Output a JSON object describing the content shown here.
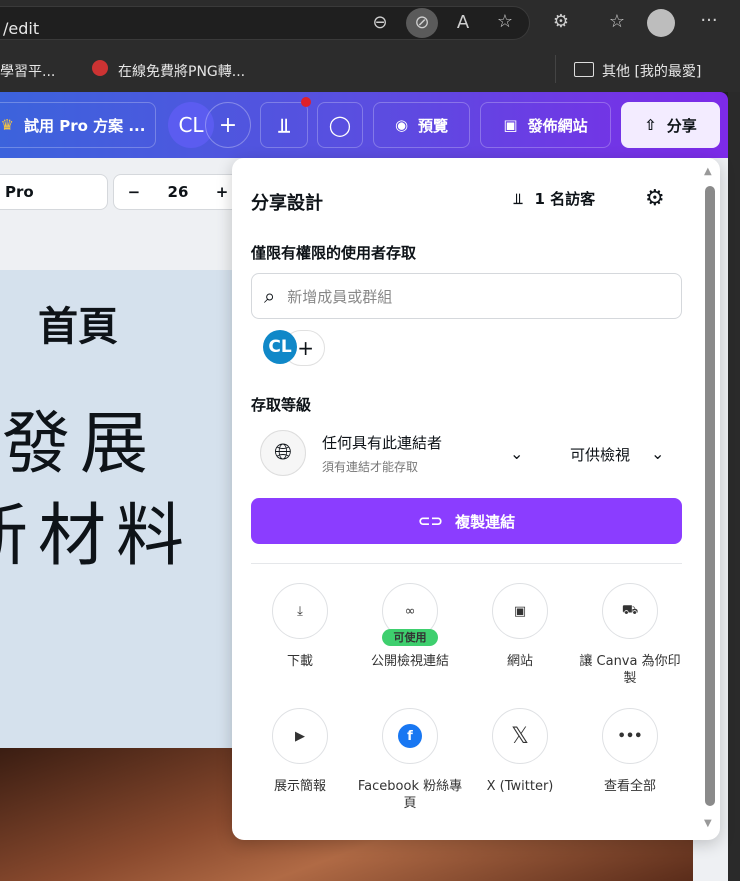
{
  "browser": {
    "url": "/edit",
    "bookmarks": [
      "學習平...",
      "在線免費將PNG轉...",
      "其他 [我的最愛]"
    ]
  },
  "topbar": {
    "try_pro": "試用 Pro 方案 ...",
    "avatar": "CL",
    "add": "+",
    "preview": "預覽",
    "publish": "發佈網站",
    "share": "分享"
  },
  "toolbar": {
    "font": "Pro",
    "font_size": "26",
    "minus": "−",
    "plus": "+"
  },
  "canvas": {
    "heading": "首頁",
    "line1": "發展",
    "line2": "新材料"
  },
  "share_panel": {
    "title": "分享設計",
    "visitors": "1 名訪客",
    "people_label": "僅限有權限的使用者存取",
    "search_placeholder": "新增成員或群組",
    "member_avatar": "CL",
    "access_label": "存取等級",
    "access_option": "任何具有此連結者",
    "access_sub": "須有連結才能存取",
    "permission": "可供檢視",
    "copy_link": "複製連結",
    "badge": "可使用",
    "options": [
      {
        "label": "下載",
        "icon": "download-icon"
      },
      {
        "label": "公開檢視連結",
        "icon": "link-icon"
      },
      {
        "label": "網站",
        "icon": "website-icon"
      },
      {
        "label": "讓 Canva 為你印製",
        "icon": "truck-icon"
      },
      {
        "label": "展示簡報",
        "icon": "present-icon"
      },
      {
        "label": "Facebook 粉絲專頁",
        "icon": "facebook-icon"
      },
      {
        "label": "X (Twitter)",
        "icon": "x-icon"
      },
      {
        "label": "查看全部",
        "icon": "more-icon"
      }
    ]
  },
  "colors": {
    "accent": "#8b3dff",
    "badge": "#3ecf6e",
    "facebook": "#1877f2"
  }
}
